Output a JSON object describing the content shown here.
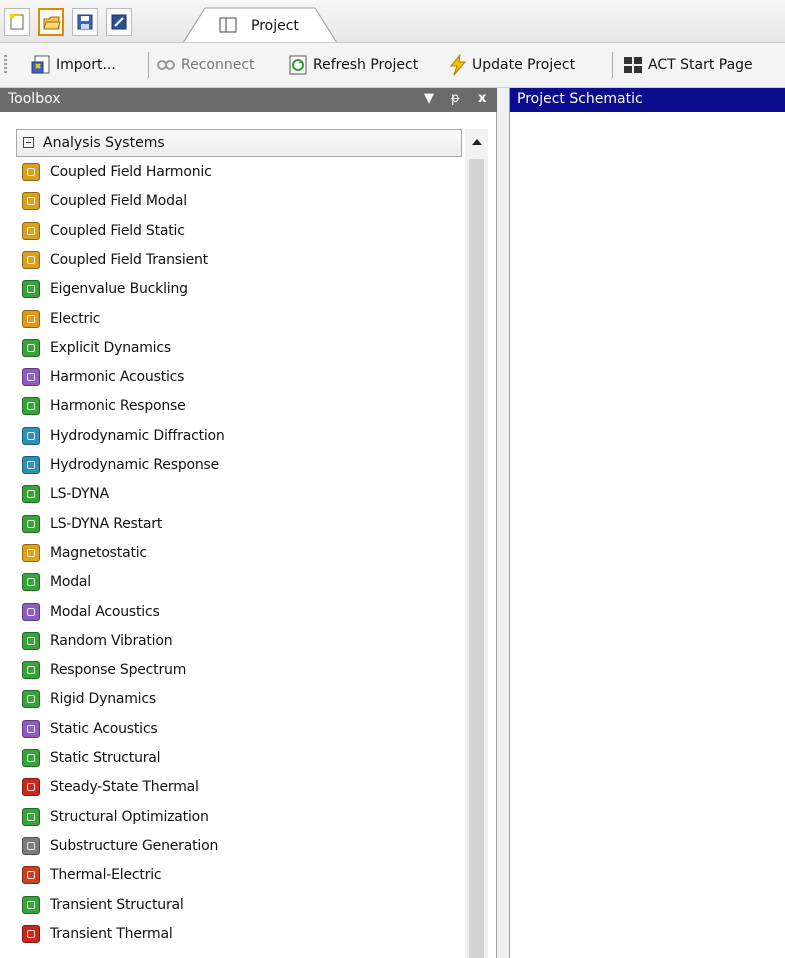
{
  "tabs": [
    {
      "label": "Project",
      "icon": "project-tab-icon"
    }
  ],
  "toolbar": {
    "import_label": "Import...",
    "reconnect_label": "Reconnect",
    "refresh_label": "Refresh Project",
    "update_label": "Update Project",
    "act_label": "ACT Start Page"
  },
  "toolbox": {
    "title": "Toolbox",
    "controls": {
      "dropdown": "▼",
      "pin": "ᵽ",
      "close": "x"
    },
    "group": {
      "label": "Analysis Systems",
      "items": [
        {
          "label": "Coupled Field Harmonic",
          "icon": "coupled-field-harmonic-icon",
          "color": "#d9a020"
        },
        {
          "label": "Coupled Field Modal",
          "icon": "coupled-field-modal-icon",
          "color": "#d9a020"
        },
        {
          "label": "Coupled Field Static",
          "icon": "coupled-field-static-icon",
          "color": "#d9a020"
        },
        {
          "label": "Coupled Field Transient",
          "icon": "coupled-field-transient-icon",
          "color": "#d9a020"
        },
        {
          "label": "Eigenvalue Buckling",
          "icon": "eigenvalue-buckling-icon",
          "color": "#3aa23a"
        },
        {
          "label": "Electric",
          "icon": "electric-icon",
          "color": "#e09a1a"
        },
        {
          "label": "Explicit Dynamics",
          "icon": "explicit-dynamics-icon",
          "color": "#3aa23a"
        },
        {
          "label": "Harmonic Acoustics",
          "icon": "harmonic-acoustics-icon",
          "color": "#8c5cc0"
        },
        {
          "label": "Harmonic Response",
          "icon": "harmonic-response-icon",
          "color": "#3aa23a"
        },
        {
          "label": "Hydrodynamic Diffraction",
          "icon": "hydrodynamic-diffraction-icon",
          "color": "#2f8fb5"
        },
        {
          "label": "Hydrodynamic Response",
          "icon": "hydrodynamic-response-icon",
          "color": "#2f8fb5"
        },
        {
          "label": "LS-DYNA",
          "icon": "ls-dyna-icon",
          "color": "#3aa23a"
        },
        {
          "label": "LS-DYNA Restart",
          "icon": "ls-dyna-restart-icon",
          "color": "#3aa23a"
        },
        {
          "label": "Magnetostatic",
          "icon": "magnetostatic-icon",
          "color": "#e0a21a"
        },
        {
          "label": "Modal",
          "icon": "modal-icon",
          "color": "#3aa23a"
        },
        {
          "label": "Modal Acoustics",
          "icon": "modal-acoustics-icon",
          "color": "#8c5cc0"
        },
        {
          "label": "Random Vibration",
          "icon": "random-vibration-icon",
          "color": "#3aa23a"
        },
        {
          "label": "Response Spectrum",
          "icon": "response-spectrum-icon",
          "color": "#3aa23a"
        },
        {
          "label": "Rigid Dynamics",
          "icon": "rigid-dynamics-icon",
          "color": "#3aa23a"
        },
        {
          "label": "Static Acoustics",
          "icon": "static-acoustics-icon",
          "color": "#8c5cc0"
        },
        {
          "label": "Static Structural",
          "icon": "static-structural-icon",
          "color": "#3aa23a"
        },
        {
          "label": "Steady-State Thermal",
          "icon": "steady-state-thermal-icon",
          "color": "#c8281e"
        },
        {
          "label": "Structural Optimization",
          "icon": "structural-optimization-icon",
          "color": "#3aa23a"
        },
        {
          "label": "Substructure Generation",
          "icon": "substructure-generation-icon",
          "color": "#7a7a7a"
        },
        {
          "label": "Thermal-Electric",
          "icon": "thermal-electric-icon",
          "color": "#c8401e"
        },
        {
          "label": "Transient Structural",
          "icon": "transient-structural-icon",
          "color": "#3aa23a"
        },
        {
          "label": "Transient Thermal",
          "icon": "transient-thermal-icon",
          "color": "#c8281e"
        }
      ]
    }
  },
  "schematic": {
    "title": "Project Schematic"
  },
  "colors": {
    "toolbox_header": "#6b6b6b",
    "schematic_header": "#0b0b8e"
  }
}
